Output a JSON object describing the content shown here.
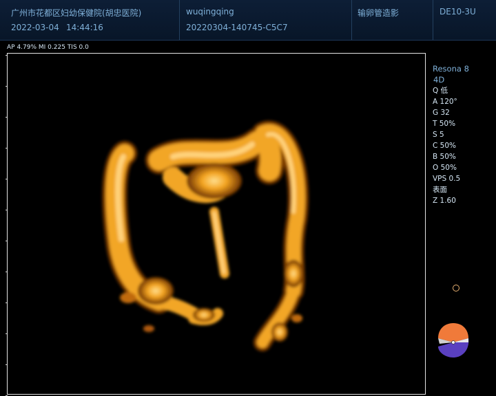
{
  "header": {
    "hospital": "广州市花都区妇幼保健院(胡忠医院)",
    "date": "2022-03-04",
    "time": "14:44:16",
    "patient_name": "wuqingqing",
    "exam_id": "20220304-140745-C5C7",
    "exam_type": "输卵管造影",
    "probe": "DE10-3U"
  },
  "params": {
    "acoustic_line": "AP 4.79%  MI 0.225  TIS 0.0"
  },
  "right_panel": {
    "model": "Resona 8",
    "mode": "4D",
    "items": [
      "Q 低",
      "A 120°",
      "G 32",
      "T 50%",
      "S 5",
      "C 50%",
      "B 50%",
      "O 50%",
      "VPS 0.5",
      "表面",
      "Z 1.60"
    ]
  },
  "colors": {
    "header_bg": "#0d1e36",
    "header_text": "#7fb0d8",
    "panel_text": "#d6e7f5",
    "render_orange": "#f0a020",
    "marker_orange": "#f07a3a",
    "marker_purple": "#5a40c0"
  }
}
